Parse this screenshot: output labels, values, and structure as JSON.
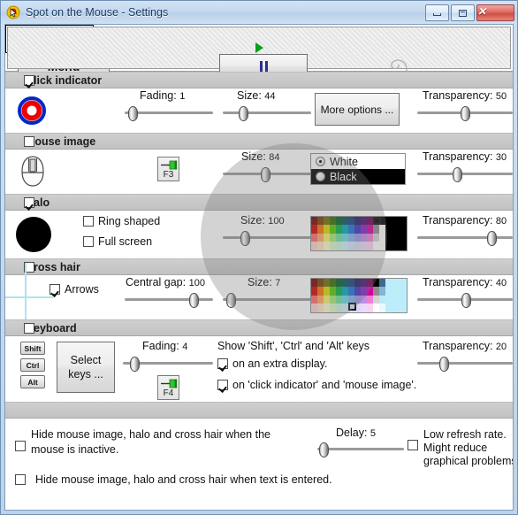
{
  "window": {
    "title": "Spot on the Mouse - Settings",
    "app_icon": "spot-mouse-icon",
    "controls": {
      "minimize": "minimize-icon",
      "maximize": "maximize-icon",
      "close": "close-icon",
      "close_glyph": "✕"
    }
  },
  "toolbar": {
    "menu_label": "Menu",
    "play_label": "play-icon",
    "pause_label": "pause-icon",
    "mouse_art": "mouse-illustration"
  },
  "sections": {
    "click_indicator": {
      "title": "Click indicator",
      "checked": true,
      "preview": "click-indicator-preview",
      "fading": {
        "label": "Fading:",
        "value": "1",
        "percent": 9
      },
      "size": {
        "label": "Size:",
        "value": "44",
        "percent": 32
      },
      "more_options_label": "More options ...",
      "transparency": {
        "label": "Transparency:",
        "value": "50",
        "percent": 50
      }
    },
    "mouse_image": {
      "title": "Mouse image",
      "checked": false,
      "preview": "mouse-image-preview",
      "fkey": {
        "label": "F3",
        "icon": "pin-icon"
      },
      "size": {
        "label": "Size:",
        "value": "84",
        "percent": 48
      },
      "color_options": [
        {
          "label": "White",
          "selected": true
        },
        {
          "label": "Black",
          "selected": false
        }
      ],
      "transparency": {
        "label": "Transparency:",
        "value": "30",
        "percent": 42
      }
    },
    "halo": {
      "title": "Halo",
      "checked": true,
      "preview": "halo-preview",
      "ring_shaped": {
        "label": "Ring shaped",
        "checked": false
      },
      "full_screen": {
        "label": "Full screen",
        "checked": false
      },
      "size": {
        "label": "Size:",
        "value": "100",
        "percent": 25
      },
      "color": "#000000",
      "transparency": {
        "label": "Transparency:",
        "value": "80",
        "percent": 78
      }
    },
    "cross_hair": {
      "title": "Cross hair",
      "checked": false,
      "preview": "cross-hair-preview",
      "arrows": {
        "label": "Arrows",
        "checked": true
      },
      "central_gap": {
        "label": "Central gap:",
        "value": "100",
        "percent": 78
      },
      "size": {
        "label": "Size:",
        "value": "7",
        "percent": 9
      },
      "color": "#b9ebf5",
      "transparency": {
        "label": "Transparency:",
        "value": "40",
        "percent": 51
      }
    },
    "keyboard": {
      "title": "Keyboard",
      "checked": false,
      "keycaps": [
        "Shift",
        "Ctrl",
        "Alt"
      ],
      "select_keys_label": "Select\nkeys ...",
      "select_keys_line1": "Select",
      "select_keys_line2": "keys ...",
      "fading": {
        "label": "Fading:",
        "value": "4",
        "percent": 13
      },
      "fkey": {
        "label": "F4",
        "icon": "pin-icon"
      },
      "show_heading": "Show 'Shift', 'Ctrl' and 'Alt' keys",
      "option_extra_display": {
        "label": "on an extra display.",
        "checked": true
      },
      "option_click_indicator": {
        "label": "on 'click indicator' and 'mouse image'.",
        "checked": true
      },
      "transparency": {
        "label": "Transparency:",
        "value": "20",
        "percent": 28
      }
    },
    "footer": {
      "hide_inactive": {
        "line1": "Hide mouse image, halo and cross hair when the",
        "line2": "mouse is inactive.",
        "checked": false
      },
      "hide_text_entered": {
        "label": "Hide mouse image, halo and cross hair when text is entered.",
        "checked": false
      },
      "delay": {
        "label": "Delay:",
        "value": "5",
        "percent": 7
      },
      "low_refresh": {
        "line1": "Low refresh rate.",
        "line2": "Might reduce",
        "line3": "graphical problems.",
        "checked": false
      }
    }
  },
  "colors": {
    "accent": "#173a5e",
    "band": "#c6c6c6",
    "click_ring_outer": "#0028c8",
    "click_ring_inner": "#ee0000",
    "halo_color": "#000000",
    "crosshair_color": "#aee3ee",
    "play_green": "#0a9e1e",
    "pause_blue": "#2b2f8f"
  }
}
